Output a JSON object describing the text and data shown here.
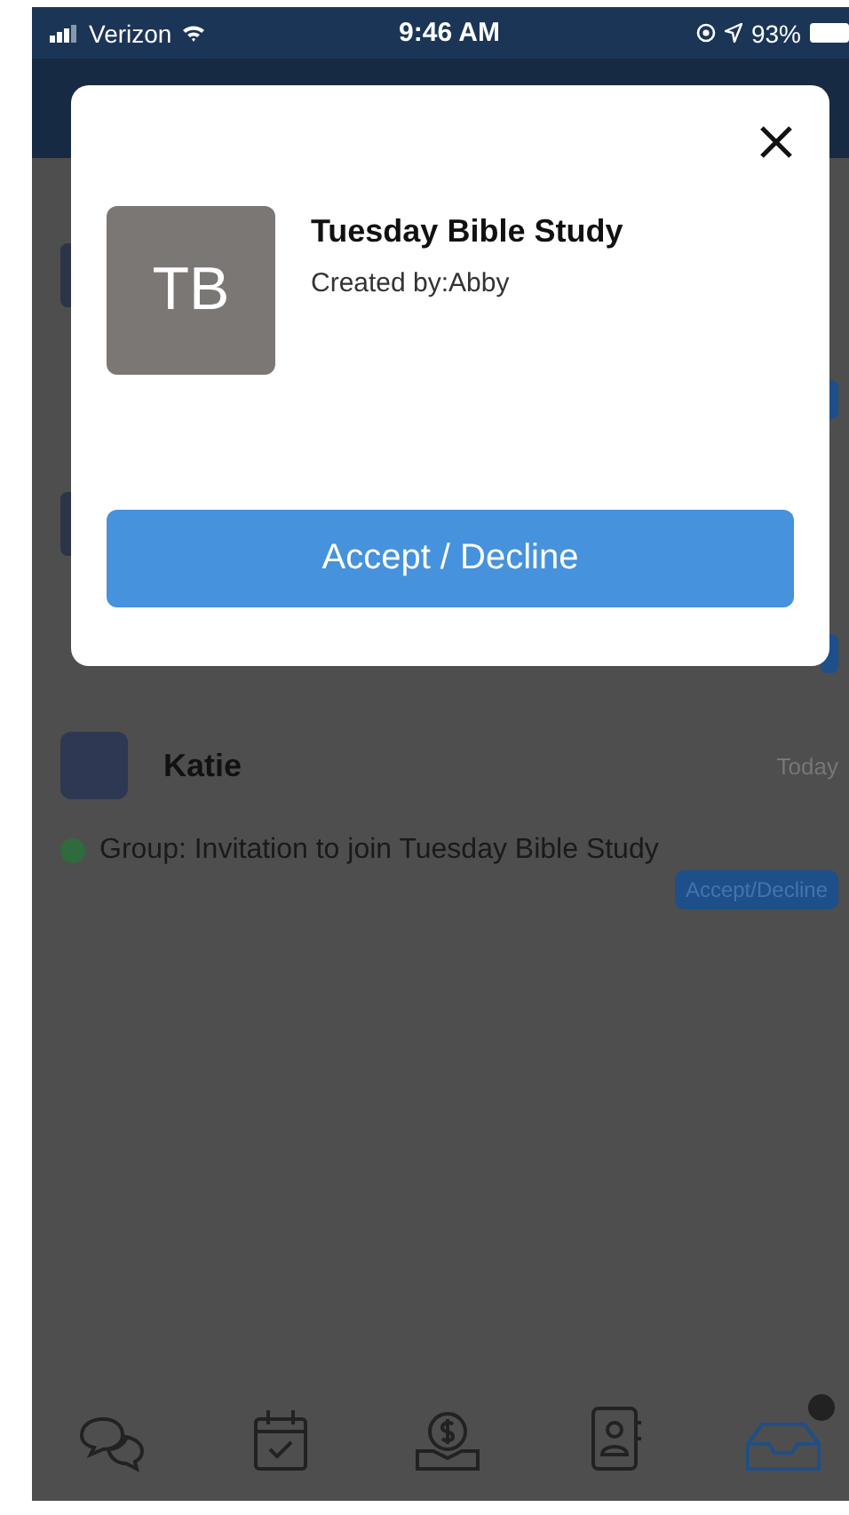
{
  "status_bar": {
    "carrier": "Verizon",
    "time": "9:46 AM",
    "battery": "93%"
  },
  "dialog": {
    "avatar_initials": "TB",
    "title": "Tuesday Bible Study",
    "subtitle": "Created by:Abby",
    "button": "Accept / Decline"
  },
  "notifications": [
    {
      "sender": "Katie",
      "date": "Today",
      "message": "Group: Invitation to join Tuesday Bible Study",
      "unread": true,
      "color": "#2f6b3c",
      "action": "Accept/Decline"
    }
  ],
  "tab_bar": [
    {
      "kind": "chat",
      "selected": false,
      "badge": false
    },
    {
      "kind": "calendar",
      "selected": false,
      "badge": false
    },
    {
      "kind": "money",
      "selected": false,
      "badge": false
    },
    {
      "kind": "contacts",
      "selected": false,
      "badge": false
    },
    {
      "kind": "inbox",
      "selected": true,
      "badge": true
    }
  ]
}
